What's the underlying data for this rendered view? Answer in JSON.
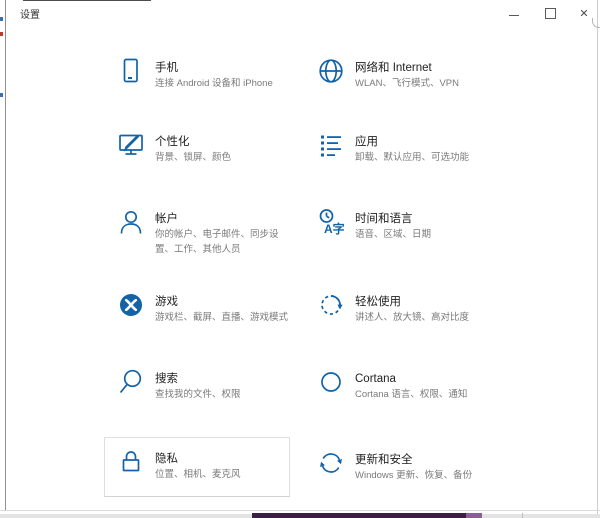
{
  "titlebar": {
    "title": "设置"
  },
  "tiles": [
    {
      "icon": "phone-icon",
      "title": "手机",
      "subtitle": "连接 Android 设备和 iPhone"
    },
    {
      "icon": "network-globe-icon",
      "title": "网络和 Internet",
      "subtitle": "WLAN、飞行模式、VPN"
    },
    {
      "icon": "personalization-icon",
      "title": "个性化",
      "subtitle": "背景、锁屏、颜色"
    },
    {
      "icon": "apps-list-icon",
      "title": "应用",
      "subtitle": "卸载、默认应用、可选功能"
    },
    {
      "icon": "accounts-person-icon",
      "title": "帐户",
      "subtitle": "你的帐户、电子邮件、同步设\n置、工作、其他人员"
    },
    {
      "icon": "time-language-icon",
      "title": "时间和语言",
      "subtitle": "语音、区域、日期"
    },
    {
      "icon": "gaming-xbox-icon",
      "title": "游戏",
      "subtitle": "游戏栏、截屏、直播、游戏模式"
    },
    {
      "icon": "ease-of-access-icon",
      "title": "轻松使用",
      "subtitle": "讲述人、放大镜、高对比度"
    },
    {
      "icon": "search-icon",
      "title": "搜索",
      "subtitle": "查找我的文件、权限"
    },
    {
      "icon": "cortana-ring-icon",
      "title": "Cortana",
      "subtitle": "Cortana 语言、权限、通知"
    },
    {
      "icon": "privacy-lock-icon",
      "title": "隐私",
      "subtitle": "位置、相机、麦克风",
      "highlighted": true
    },
    {
      "icon": "update-security-icon",
      "title": "更新和安全",
      "subtitle": "Windows 更新、恢复、备份"
    }
  ],
  "icon_glyphs": {
    "time_language_text": "A字"
  },
  "colors": {
    "accent": "#1263A8",
    "title_text": "#222222",
    "subtitle_text": "#7A7A7A",
    "highlight_border": "#DEDEDE",
    "taskbar_purple_dark": "#3A1E43",
    "taskbar_purple_light": "#8C5F94"
  }
}
